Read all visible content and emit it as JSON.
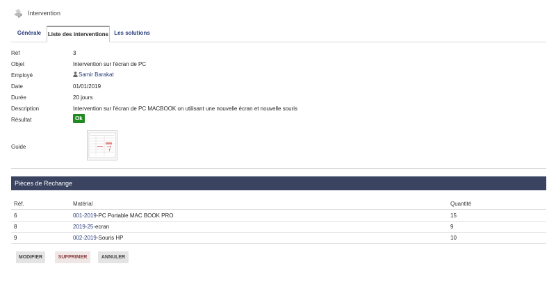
{
  "header": {
    "title": "Intervention"
  },
  "tabs": [
    {
      "label": "Générale"
    },
    {
      "label": "Liste des interventions"
    },
    {
      "label": "Les solutions"
    }
  ],
  "fields": {
    "ref": {
      "label": "Réf",
      "value": "3"
    },
    "objet": {
      "label": "Objet",
      "value": "Intervention sur l'écran de PC"
    },
    "employe": {
      "label": "Employé",
      "value": "Samir Barakat"
    },
    "date": {
      "label": "Date",
      "value": "01/01/2019"
    },
    "duree": {
      "label": "Durée",
      "value": "20 jours"
    },
    "description": {
      "label": "Description",
      "value": "Intervention sur l'écran de PC MACBOOK on utilisant une nouvelle écran et nouvelle souris"
    },
    "resultat": {
      "label": "Résultat",
      "value": "Ok"
    },
    "guide": {
      "label": "Guide"
    }
  },
  "pieces": {
    "title": "Pièces de Rechange",
    "columns": [
      "Réf.",
      "Matérial",
      "Quantité"
    ],
    "rows": [
      {
        "ref": "6",
        "code": "001-2019",
        "name": "-PC Portable MAC BOOK PRO",
        "qty": "15"
      },
      {
        "ref": "8",
        "code": "2019-25",
        "name": "-ecran",
        "qty": "9"
      },
      {
        "ref": "9",
        "code": "002-2019",
        "name": "-Souris HP",
        "qty": "10"
      }
    ]
  },
  "buttons": {
    "modify": "MODIFIER",
    "delete": "SUPPRIMER",
    "cancel": "ANNULER"
  },
  "colors": {
    "link": "#263c7a",
    "panel": "#3a4461",
    "ok": "#1f8a1f"
  },
  "icons": {
    "app": "tools-icon",
    "employee": "user-icon"
  }
}
